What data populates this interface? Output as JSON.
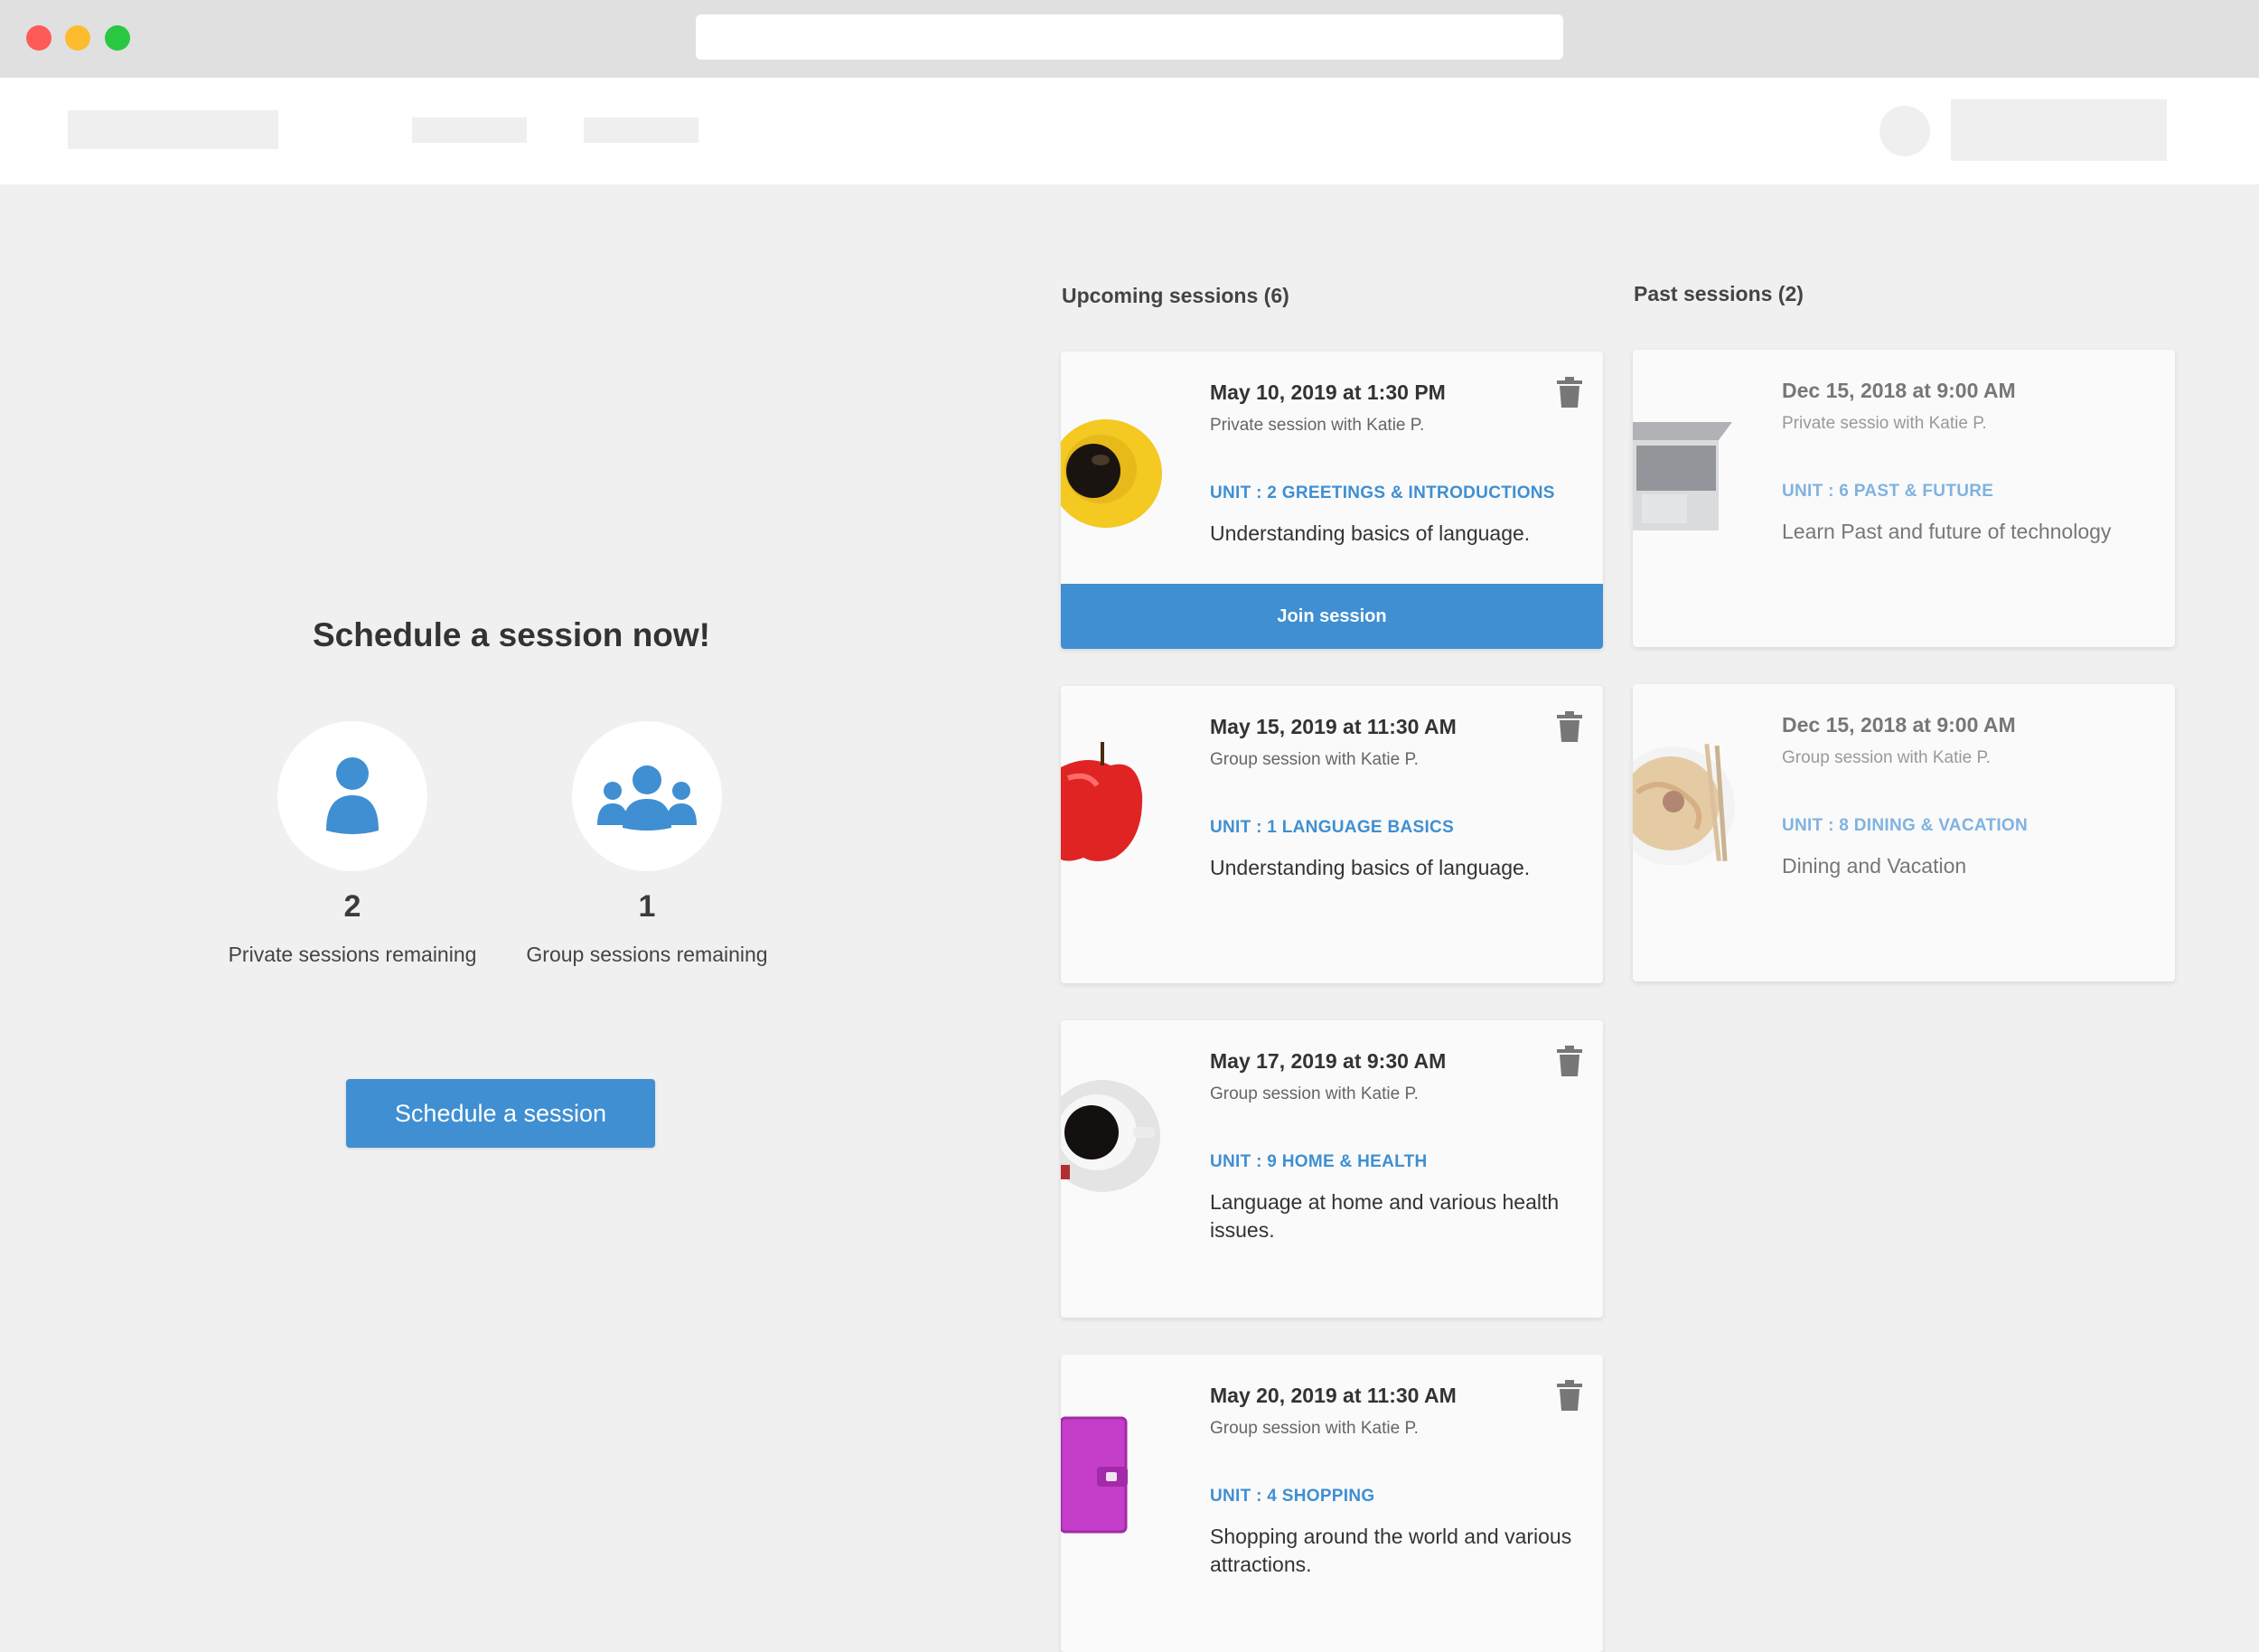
{
  "browser": {
    "address": ""
  },
  "schedule": {
    "title": "Schedule a session now!",
    "private": {
      "count": "2",
      "label": "Private sessions remaining"
    },
    "group": {
      "count": "1",
      "label": "Group sessions remaining"
    },
    "button_label": "Schedule a session"
  },
  "upcoming": {
    "heading": "Upcoming sessions (6)",
    "sessions": [
      {
        "datetime": "May 10, 2019 at 1:30 PM",
        "subtitle": "Private session with Katie P.",
        "unit": "UNIT : 2 GREETINGS & INTRODUCTIONS",
        "description": "Understanding basics of language.",
        "thumbnail": "coffee-yellow-cup",
        "join_label": "Join session"
      },
      {
        "datetime": "May 15, 2019 at 11:30 AM",
        "subtitle": "Group session with Katie P.",
        "unit": "UNIT : 1  LANGUAGE BASICS",
        "description": "Understanding basics of language.",
        "thumbnail": "red-apple"
      },
      {
        "datetime": "May 17, 2019 at 9:30 AM",
        "subtitle": "Group session with Katie P.",
        "unit": "UNIT : 9  HOME & HEALTH",
        "description": "Language at home and various health issues.",
        "thumbnail": "coffee-white-cup"
      },
      {
        "datetime": "May 20, 2019 at 11:30 AM",
        "subtitle": "Group session with Katie P.",
        "unit": "UNIT : 4  SHOPPING",
        "description": "Shopping around the world and various attractions.",
        "thumbnail": "pink-wallet"
      }
    ]
  },
  "past": {
    "heading": "Past sessions (2)",
    "sessions": [
      {
        "datetime": "Dec 15, 2018 at 9:00 AM",
        "subtitle": "Private sessio with Katie P.",
        "unit": "UNIT : 6  PAST & FUTURE",
        "description": "Learn Past and future of technology",
        "thumbnail": "laptop"
      },
      {
        "datetime": "Dec 15, 2018 at 9:00 AM",
        "subtitle": "Group session with Katie P.",
        "unit": "UNIT : 8  DINING & VACATION",
        "description": "Dining and Vacation",
        "thumbnail": "noodle-bowl"
      }
    ]
  },
  "colors": {
    "accent": "#3f8fd2",
    "background": "#f0f0f0",
    "card": "#fafafa"
  }
}
